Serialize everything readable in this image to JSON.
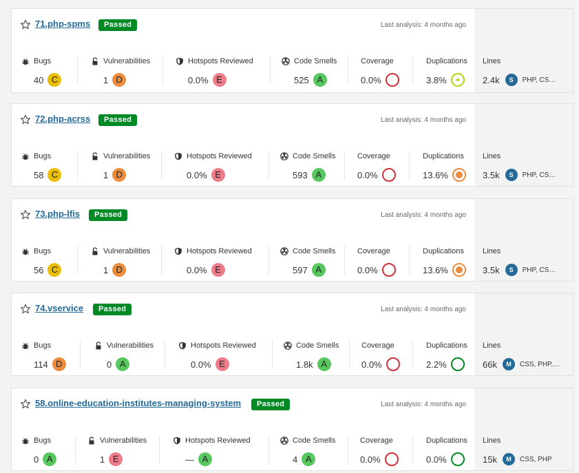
{
  "labels": {
    "bugs": "Bugs",
    "vulnerabilities": "Vulnerabilities",
    "hotspots": "Hotspots Reviewed",
    "code_smells": "Code Smells",
    "coverage": "Coverage",
    "duplications": "Duplications",
    "lines": "Lines"
  },
  "projects": [
    {
      "name": "71.php-spms",
      "status": "Passed",
      "last_analysis": "Last analysis: 4 months ago",
      "bugs": "40",
      "bugs_rating": "C",
      "vulnerabilities": "1",
      "vulnerabilities_rating": "D",
      "hotspots": "0.0%",
      "hotspots_rating": "E",
      "code_smells": "525",
      "code_smells_rating": "A",
      "coverage": "0.0%",
      "duplications": "3.8%",
      "duplications_indicator": "lime-small",
      "lines": "2.4k",
      "size": "S",
      "languages": "PHP, CS…"
    },
    {
      "name": "72.php-acrss",
      "status": "Passed",
      "last_analysis": "Last analysis: 4 months ago",
      "bugs": "58",
      "bugs_rating": "C",
      "vulnerabilities": "1",
      "vulnerabilities_rating": "D",
      "hotspots": "0.0%",
      "hotspots_rating": "E",
      "code_smells": "593",
      "code_smells_rating": "A",
      "coverage": "0.0%",
      "duplications": "13.6%",
      "duplications_indicator": "orange",
      "lines": "3.5k",
      "size": "S",
      "languages": "PHP, CS…"
    },
    {
      "name": "73.php-lfis",
      "status": "Passed",
      "last_analysis": "Last analysis: 4 months ago",
      "bugs": "56",
      "bugs_rating": "C",
      "vulnerabilities": "1",
      "vulnerabilities_rating": "D",
      "hotspots": "0.0%",
      "hotspots_rating": "E",
      "code_smells": "597",
      "code_smells_rating": "A",
      "coverage": "0.0%",
      "duplications": "13.6%",
      "duplications_indicator": "orange",
      "lines": "3.5k",
      "size": "S",
      "languages": "PHP, CS…"
    },
    {
      "name": "74.vservice",
      "status": "Passed",
      "last_analysis": "Last analysis: 4 months ago",
      "bugs": "114",
      "bugs_rating": "D",
      "vulnerabilities": "0",
      "vulnerabilities_rating": "A",
      "hotspots": "0.0%",
      "hotspots_rating": "E",
      "code_smells": "1.8k",
      "code_smells_rating": "A",
      "coverage": "0.0%",
      "duplications": "2.2%",
      "duplications_indicator": "green",
      "lines": "66k",
      "size": "M",
      "languages": "CSS, PHP,…"
    },
    {
      "name": "58.online-education-institutes-managing-system",
      "status": "Passed",
      "last_analysis": "Last analysis: 4 months ago",
      "bugs": "0",
      "bugs_rating": "A",
      "vulnerabilities": "1",
      "vulnerabilities_rating": "E",
      "hotspots": "—",
      "hotspots_rating": "A",
      "code_smells": "4",
      "code_smells_rating": "A",
      "coverage": "0.0%",
      "duplications": "0.0%",
      "duplications_indicator": "green",
      "lines": "15k",
      "size": "M",
      "languages": "CSS, PHP"
    }
  ],
  "icons": {
    "star": "star-icon",
    "bugs": "bug-icon",
    "vulnerabilities": "lock-icon",
    "hotspots": "shield-icon",
    "code_smells": "radiation-icon"
  },
  "colors": {
    "passed": "#008a25",
    "rating_A": "#58c760",
    "rating_C": "#eabe06",
    "rating_D": "#ed8c3c",
    "rating_E": "#ed7d8a",
    "coverage_ring": "#d02f3a",
    "link": "#236a97"
  }
}
